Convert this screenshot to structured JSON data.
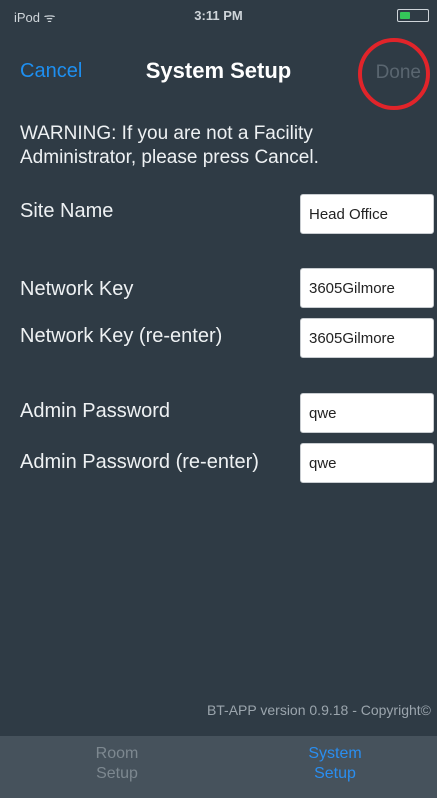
{
  "status_bar": {
    "carrier": "iPod ᯤ",
    "time": "3:11 PM"
  },
  "nav": {
    "cancel_label": "Cancel",
    "title": "System Setup",
    "done_label": "Done"
  },
  "warning": "WARNING: If you are not a Facility Administrator, please press Cancel.",
  "form": {
    "site_name": {
      "label": "Site Name",
      "value": "Head Office"
    },
    "network_key": {
      "label": "Network Key",
      "value": "3605Gilmore"
    },
    "network_key_reenter": {
      "label": "Network Key (re-enter)",
      "value": "3605Gilmore"
    },
    "admin_password": {
      "label": "Admin Password",
      "value": "qwe"
    },
    "admin_password_reenter": {
      "label": "Admin Password (re-enter)",
      "value": "qwe"
    }
  },
  "footer": {
    "version_text": "BT-APP version 0.9.18 - Copyright©"
  },
  "tabs": {
    "room_setup": "Room\nSetup",
    "system_setup": "System\nSetup"
  },
  "colors": {
    "background": "#2f3b45",
    "accent_blue": "#1e8ff0",
    "highlight_red": "#e1242a",
    "tab_bar": "#46525c"
  }
}
